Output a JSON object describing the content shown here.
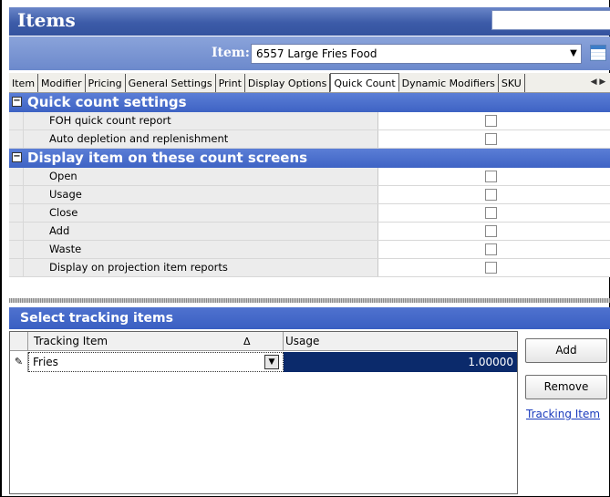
{
  "window": {
    "title": "Items"
  },
  "item_selector": {
    "label": "Item:",
    "value": "6557 Large Fries Food",
    "dropdown_icon": "chevron-down-icon",
    "grid_icon": "grid-icon"
  },
  "tabs": [
    {
      "label": "Item",
      "active": false
    },
    {
      "label": "Modifier",
      "active": false
    },
    {
      "label": "Pricing",
      "active": false
    },
    {
      "label": "General Settings",
      "active": false
    },
    {
      "label": "Print",
      "active": false
    },
    {
      "label": "Display Options",
      "active": false
    },
    {
      "label": "Quick Count",
      "active": true
    },
    {
      "label": "Dynamic Modifiers",
      "active": false
    },
    {
      "label": "SKU",
      "active": false
    }
  ],
  "quick_count_settings": {
    "header": "Quick count settings",
    "rows": [
      {
        "label": "FOH quick count report",
        "checked": false
      },
      {
        "label": "Auto depletion and replenishment",
        "checked": false
      }
    ]
  },
  "count_screens": {
    "header": "Display item on these count screens",
    "rows": [
      {
        "label": "Open",
        "checked": false
      },
      {
        "label": "Usage",
        "checked": false
      },
      {
        "label": "Close",
        "checked": false
      },
      {
        "label": "Add",
        "checked": false
      },
      {
        "label": "Waste",
        "checked": false
      },
      {
        "label": "Display on projection item reports",
        "checked": false
      }
    ]
  },
  "tracking": {
    "header": "Select tracking items",
    "columns": {
      "tracking_item": "Tracking Item",
      "usage": "Usage",
      "sort_indicator": "Δ"
    },
    "rows": [
      {
        "item": "Fries",
        "usage": "1.00000"
      }
    ],
    "add_label": "Add",
    "remove_label": "Remove",
    "link_label": "Tracking Item"
  },
  "colors": {
    "title_bar": "#3c5ba8",
    "category_header": "#4a6fd0",
    "selected_cell": "#0b2a6b",
    "link": "#1a3bbd"
  }
}
